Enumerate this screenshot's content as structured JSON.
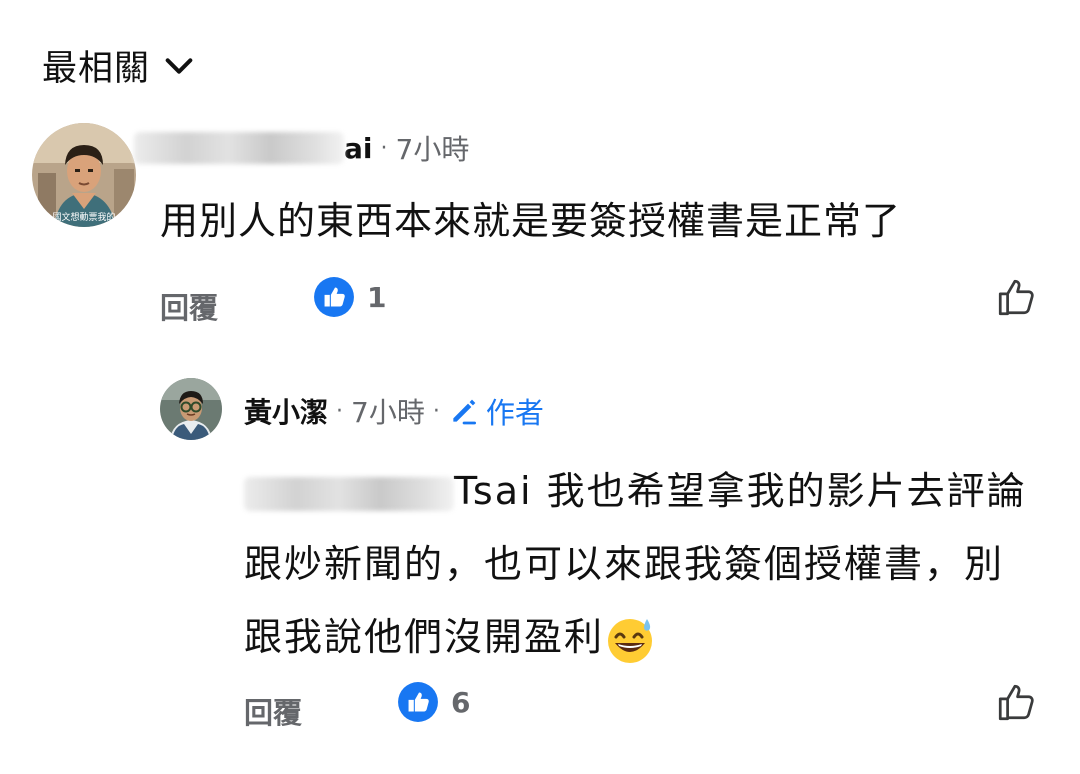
{
  "sort": {
    "label": "最相關",
    "icon": "chevron-down-icon"
  },
  "comments": [
    {
      "author_visible_suffix": "ai",
      "author_redacted": true,
      "time": "7小時",
      "body": "用別人的東西本來就是要簽授權書是正常了",
      "avatar_caption": "國文想動票我的",
      "reply_label": "回覆",
      "like_count": "1"
    }
  ],
  "reply": {
    "author": "黃小潔",
    "time": "7小時",
    "author_badge": "作者",
    "mention_visible_suffix": "Tsai",
    "mention_redacted": true,
    "body": " 我也希望拿我的影片去評論跟炒新聞的，也可以來跟我簽個授權書，別跟我說他們沒開盈利",
    "emoji": "grinning-sweat-emoji",
    "reply_label": "回覆",
    "like_count": "6"
  },
  "colors": {
    "accent": "#1877f2",
    "meta": "#65676b",
    "text": "#111111"
  }
}
